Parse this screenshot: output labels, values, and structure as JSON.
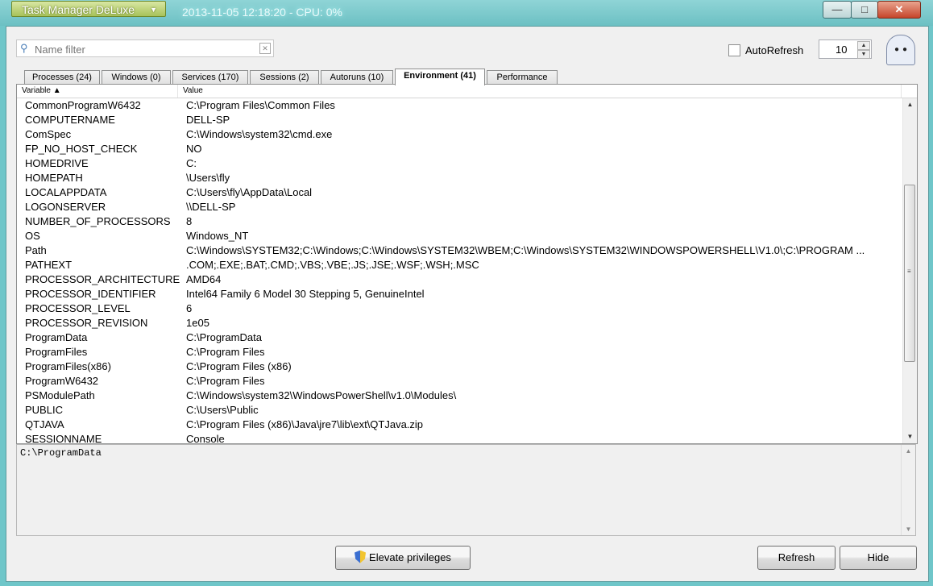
{
  "window": {
    "app_menu_label": "Task Manager DeLuxe",
    "title": "2013-11-05 12:18:20 - CPU: 0%",
    "minimize": "—",
    "maximize": "□",
    "close": "✕"
  },
  "toolbar": {
    "filter_placeholder": "Name filter",
    "filter_value": "",
    "autorefresh_label": "AutoRefresh",
    "autorefresh_checked": false,
    "interval_value": "10"
  },
  "tabs": [
    {
      "label": "Processes (24)",
      "active": false
    },
    {
      "label": "Windows (0)",
      "active": false
    },
    {
      "label": "Services (170)",
      "active": false
    },
    {
      "label": "Sessions (2)",
      "active": false
    },
    {
      "label": "Autoruns (10)",
      "active": false
    },
    {
      "label": "Environment (41)",
      "active": true
    },
    {
      "label": "Performance",
      "active": false
    }
  ],
  "grid": {
    "columns": [
      "Variable",
      "Value"
    ],
    "rows": [
      [
        "CommonProgramW6432",
        "C:\\Program Files\\Common Files"
      ],
      [
        "COMPUTERNAME",
        "DELL-SP"
      ],
      [
        "ComSpec",
        "C:\\Windows\\system32\\cmd.exe"
      ],
      [
        "FP_NO_HOST_CHECK",
        "NO"
      ],
      [
        "HOMEDRIVE",
        "C:"
      ],
      [
        "HOMEPATH",
        "\\Users\\fly"
      ],
      [
        "LOCALAPPDATA",
        "C:\\Users\\fly\\AppData\\Local"
      ],
      [
        "LOGONSERVER",
        "\\\\DELL-SP"
      ],
      [
        "NUMBER_OF_PROCESSORS",
        "8"
      ],
      [
        "OS",
        "Windows_NT"
      ],
      [
        "Path",
        "C:\\Windows\\SYSTEM32;C:\\Windows;C:\\Windows\\SYSTEM32\\WBEM;C:\\Windows\\SYSTEM32\\WINDOWSPOWERSHELL\\V1.0\\;C:\\PROGRAM ..."
      ],
      [
        "PATHEXT",
        ".COM;.EXE;.BAT;.CMD;.VBS;.VBE;.JS;.JSE;.WSF;.WSH;.MSC"
      ],
      [
        "PROCESSOR_ARCHITECTURE",
        "AMD64"
      ],
      [
        "PROCESSOR_IDENTIFIER",
        "Intel64 Family 6 Model 30 Stepping 5, GenuineIntel"
      ],
      [
        "PROCESSOR_LEVEL",
        "6"
      ],
      [
        "PROCESSOR_REVISION",
        "1e05"
      ],
      [
        "ProgramData",
        "C:\\ProgramData"
      ],
      [
        "ProgramFiles",
        "C:\\Program Files"
      ],
      [
        "ProgramFiles(x86)",
        "C:\\Program Files (x86)"
      ],
      [
        "ProgramW6432",
        "C:\\Program Files"
      ],
      [
        "PSModulePath",
        "C:\\Windows\\system32\\WindowsPowerShell\\v1.0\\Modules\\"
      ],
      [
        "PUBLIC",
        "C:\\Users\\Public"
      ],
      [
        "QTJAVA",
        "C:\\Program Files (x86)\\Java\\jre7\\lib\\ext\\QTJava.zip"
      ],
      [
        "SESSIONNAME",
        "Console"
      ]
    ]
  },
  "detail": {
    "text": "C:\\ProgramData"
  },
  "buttons": {
    "elevate": "Elevate privileges",
    "refresh": "Refresh",
    "hide": "Hide"
  },
  "colors": {
    "titlebar": "#6fc6c9",
    "app_button": "#a7c25a"
  }
}
